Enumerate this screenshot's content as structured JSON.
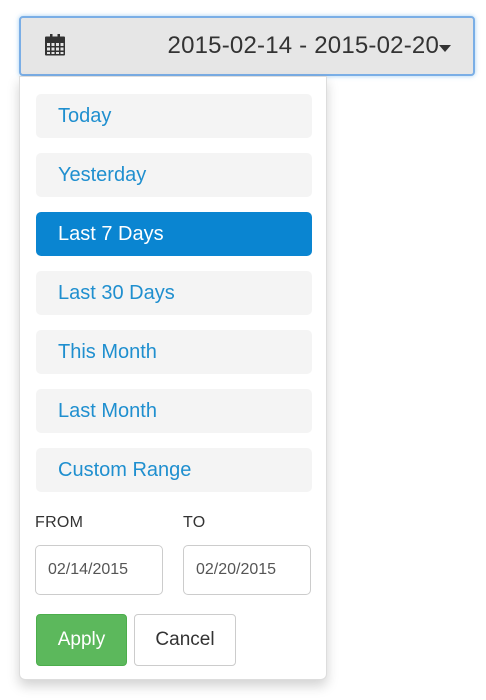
{
  "picker": {
    "calendar_icon": "calendar-icon",
    "range_text": "2015-02-14 - 2015-02-20",
    "caret_icon": "caret-down-icon"
  },
  "ranges": [
    {
      "label": "Today",
      "active": false
    },
    {
      "label": "Yesterday",
      "active": false
    },
    {
      "label": "Last 7 Days",
      "active": true
    },
    {
      "label": "Last 30 Days",
      "active": false
    },
    {
      "label": "This Month",
      "active": false
    },
    {
      "label": "Last Month",
      "active": false
    },
    {
      "label": "Custom Range",
      "active": false
    }
  ],
  "inputs": {
    "from_label": "FROM",
    "from_value": "02/14/2015",
    "to_label": "TO",
    "to_value": "02/20/2015"
  },
  "buttons": {
    "apply_label": "Apply",
    "cancel_label": "Cancel"
  },
  "colors": {
    "accent": "#0a85d1",
    "link": "#1f8fcf",
    "apply": "#5cb85c"
  }
}
